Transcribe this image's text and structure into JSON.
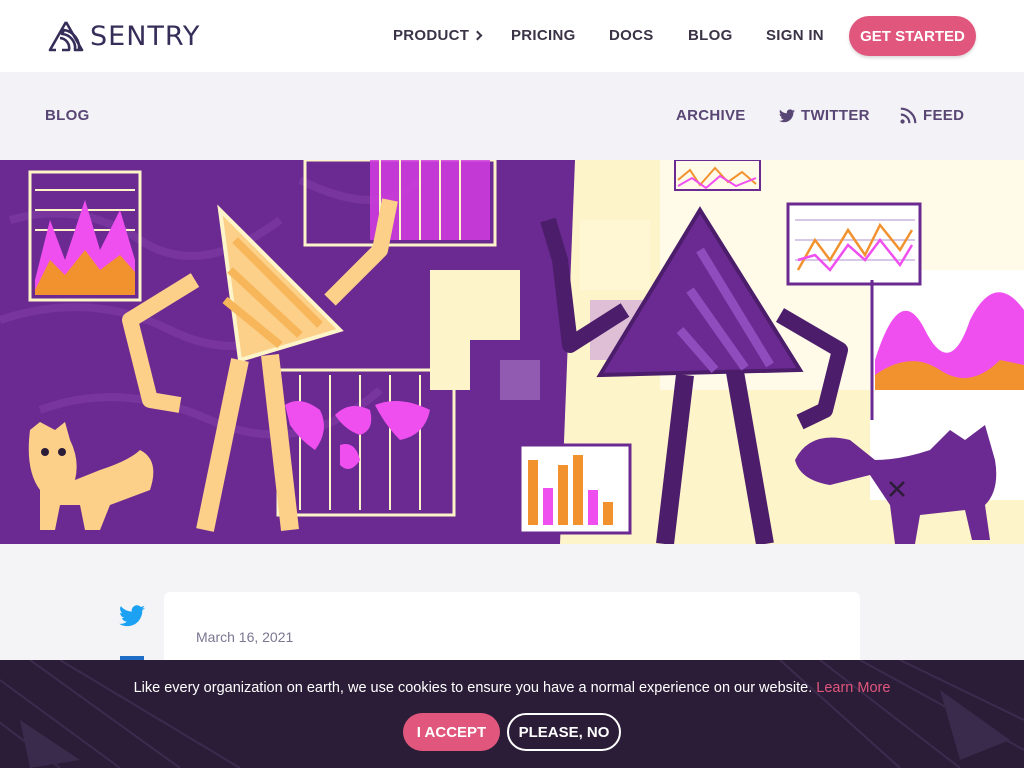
{
  "brand": {
    "name": "SENTRY",
    "accent": "#e1567c",
    "dark": "#362d59"
  },
  "nav": {
    "product": "PRODUCT",
    "pricing": "PRICING",
    "docs": "DOCS",
    "blog": "BLOG",
    "sign_in": "SIGN IN",
    "get_started": "GET STARTED"
  },
  "subnav": {
    "blog": "BLOG",
    "archive": "ARCHIVE",
    "twitter": "TWITTER",
    "feed": "FEED"
  },
  "hero": {
    "icons": [
      "sentry-mascot-light",
      "sentry-mascot-dark",
      "cat-orange",
      "cat-purple",
      "area-chart",
      "line-chart",
      "bar-chart",
      "world-map"
    ],
    "colors": {
      "purple": "#6b2a91",
      "cream": "#fdf5c9",
      "orange": "#f2922f",
      "pink": "#f04ff0"
    }
  },
  "post": {
    "date": "March 16, 2021"
  },
  "share": {
    "icons": [
      "twitter-icon",
      "linkedin-icon"
    ]
  },
  "cookie_banner": {
    "message": "Like every organization on earth, we use cookies to ensure you have a normal experience on our website.",
    "link_text": "Learn More",
    "accept": "I ACCEPT",
    "decline": "PLEASE, NO"
  }
}
